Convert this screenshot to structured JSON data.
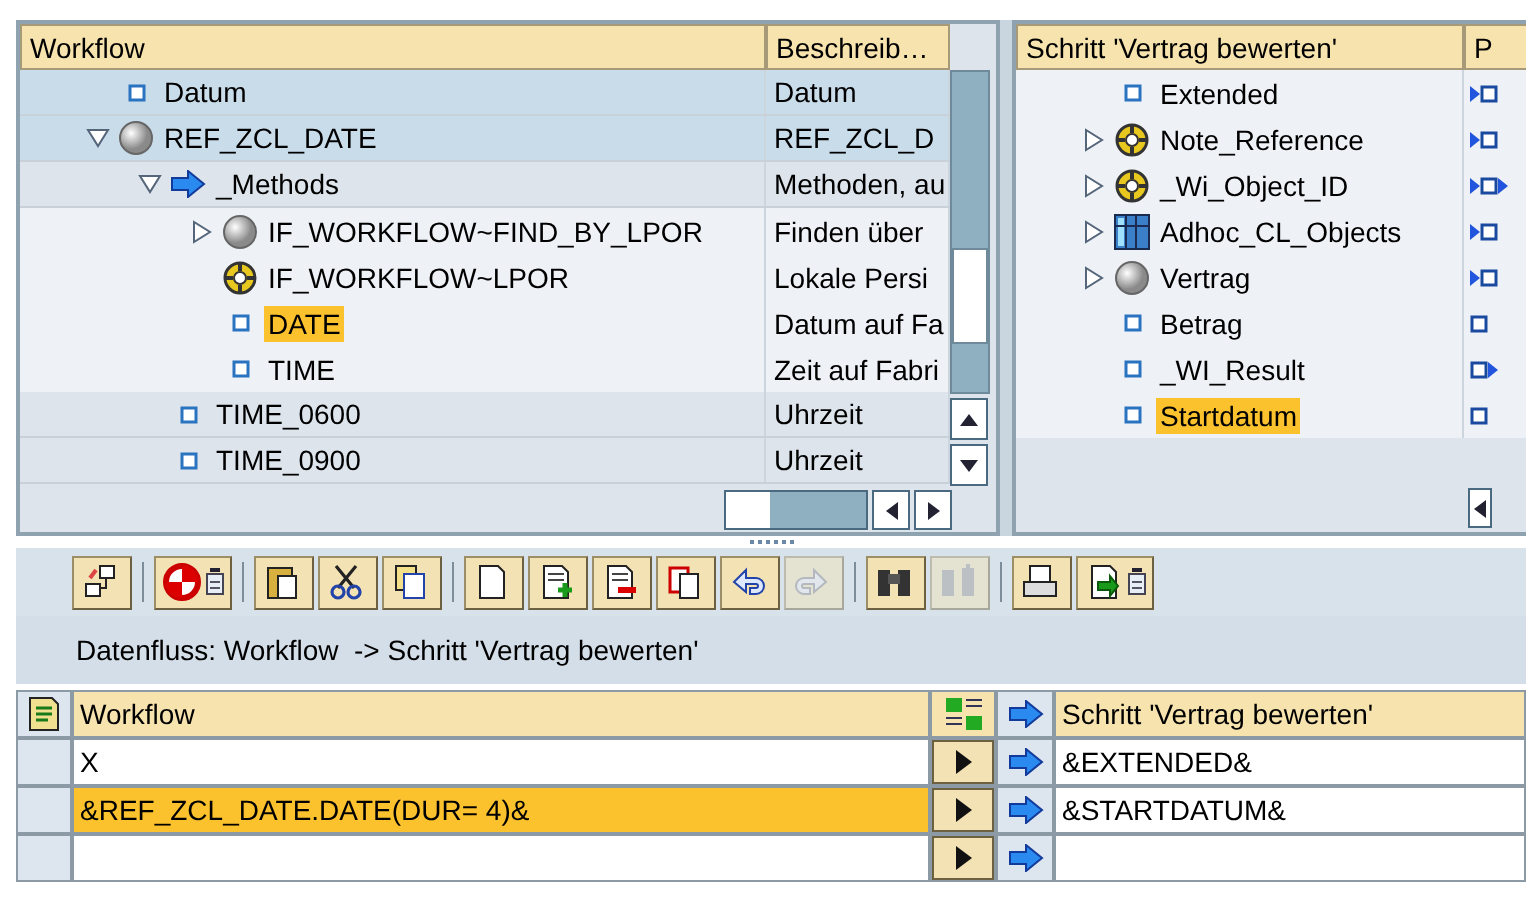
{
  "workflow_tree": {
    "columns": [
      "Workflow",
      "Beschreib…"
    ],
    "items": [
      {
        "label": "Datum",
        "description": "Datum",
        "kind": "element",
        "selected": false
      },
      {
        "label": "REF_ZCL_DATE",
        "description": "REF_ZCL_D",
        "kind": "object",
        "expanded": true,
        "selected": false,
        "children": [
          {
            "label": "_Methods",
            "description": "Methoden, au",
            "kind": "method-group",
            "expanded": true,
            "selected": false,
            "children": [
              {
                "label": "IF_WORKFLOW~FIND_BY_LPOR",
                "description": "Finden über",
                "kind": "object",
                "expanded": false,
                "selected": false
              },
              {
                "label": "IF_WORKFLOW~LPOR",
                "description": "Lokale Persi",
                "kind": "interface",
                "selected": false
              },
              {
                "label": "DATE",
                "description": "Datum auf Fa",
                "kind": "element",
                "selected": true
              },
              {
                "label": "TIME",
                "description": "Zeit auf Fabri",
                "kind": "element",
                "selected": false
              }
            ]
          },
          {
            "label": "TIME_0600",
            "description": "Uhrzeit",
            "kind": "element",
            "selected": false
          },
          {
            "label": "TIME_0900",
            "description": "Uhrzeit",
            "kind": "element",
            "selected": false
          }
        ]
      }
    ]
  },
  "step_tree": {
    "columns": [
      "Schritt 'Vertrag bewerten'",
      "P"
    ],
    "items": [
      {
        "label": "Extended",
        "kind": "element",
        "parameter": {
          "kind": "import"
        },
        "selected": false
      },
      {
        "label": "Note_Reference",
        "kind": "interface",
        "expanded": false,
        "parameter": {
          "kind": "import"
        },
        "selected": false
      },
      {
        "label": "_Wi_Object_ID",
        "kind": "interface",
        "expanded": false,
        "parameter": {
          "kind": "both"
        },
        "selected": false
      },
      {
        "label": "Adhoc_CL_Objects",
        "kind": "table",
        "expanded": false,
        "parameter": {
          "kind": "import"
        },
        "selected": false
      },
      {
        "label": "Vertrag",
        "kind": "object",
        "expanded": false,
        "parameter": {
          "kind": "import"
        },
        "selected": false
      },
      {
        "label": "Betrag",
        "kind": "element",
        "parameter": {
          "kind": "none"
        },
        "selected": false
      },
      {
        "label": "_WI_Result",
        "kind": "element",
        "parameter": {
          "kind": "export"
        },
        "selected": false
      },
      {
        "label": "Startdatum",
        "kind": "element",
        "parameter": {
          "kind": "none"
        },
        "selected": true
      }
    ]
  },
  "toolbar": [
    {
      "buttons": [
        {
          "kind": "hierarchy",
          "disabled": false
        }
      ]
    },
    {
      "buttons": [
        {
          "kind": "check",
          "disabled": false,
          "menu": true
        }
      ]
    },
    {
      "buttons": [
        {
          "kind": "paste",
          "disabled": false
        },
        {
          "kind": "cut",
          "disabled": false
        },
        {
          "kind": "copy",
          "disabled": false
        }
      ]
    },
    {
      "buttons": [
        {
          "kind": "new",
          "disabled": false
        },
        {
          "kind": "insert-row",
          "disabled": false
        },
        {
          "kind": "delete-row",
          "disabled": false
        },
        {
          "kind": "copy-row",
          "disabled": false
        },
        {
          "kind": "undo",
          "disabled": false
        },
        {
          "kind": "redo",
          "disabled": true
        }
      ]
    },
    {
      "buttons": [
        {
          "kind": "find",
          "disabled": false
        },
        {
          "kind": "find-next",
          "disabled": true
        }
      ]
    },
    {
      "buttons": [
        {
          "kind": "print",
          "disabled": false
        },
        {
          "kind": "export",
          "disabled": false,
          "menu": true
        }
      ]
    }
  ],
  "dataflow_title": "Datenfluss: Workflow  -> Schritt 'Vertrag bewerten'",
  "binding_table": {
    "columns": [
      "Workflow",
      "Schritt 'Vertrag bewerten'"
    ],
    "rows": [
      {
        "source": "X",
        "target": "&EXTENDED&",
        "selected": false
      },
      {
        "source": "&REF_ZCL_DATE.DATE(DUR= 4)&",
        "target": "&STARTDATUM&",
        "selected": true
      },
      {
        "source": "",
        "target": "",
        "selected": false
      }
    ]
  }
}
